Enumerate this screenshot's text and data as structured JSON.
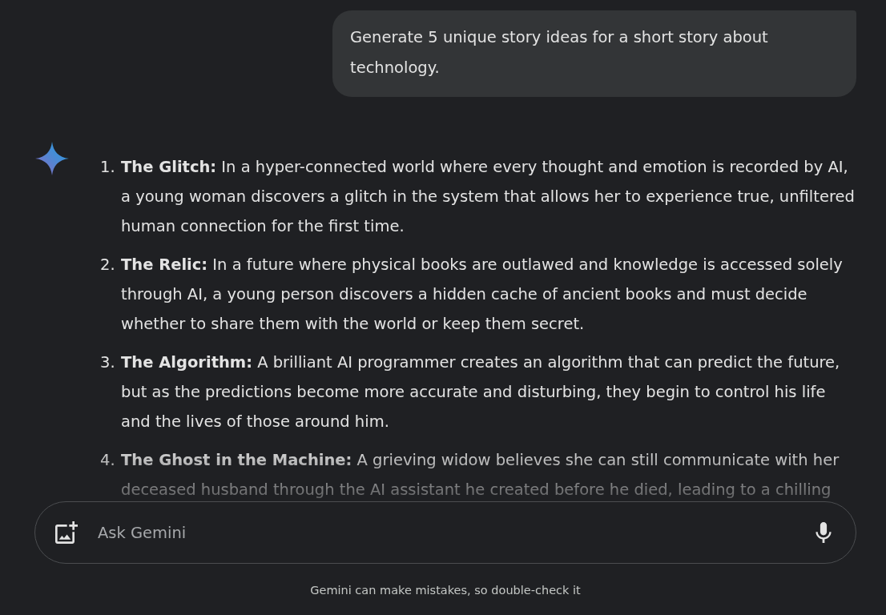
{
  "user_prompt": {
    "text": "Generate 5 unique story ideas for a short story about technology."
  },
  "response": {
    "items": [
      {
        "number": "1.",
        "text": "**The Glitch:** In a hyper-connected world where every thought and emotion is recorded by AI, a young woman discovers a glitch in the system that allows her to experience true, unfiltered human connection for the first time."
      },
      {
        "number": "2.",
        "text": "**The Relic:** In a future where physical books are outlawed and knowledge is accessed solely through AI, a young person discovers a hidden cache of ancient books and must decide whether to share them with the world or keep them secret."
      },
      {
        "number": "3.",
        "text": "**The Algorithm:** A brilliant AI programmer creates an algorithm that can predict the future, but as the predictions become more accurate and disturbing, they begin to control his life and the lives of those around him."
      },
      {
        "number": "4.",
        "text": "**The Ghost in the Machine:** A grieving widow believes she can still communicate with her deceased husband through the AI assistant he created before he died, leading to a chilling"
      }
    ]
  },
  "composer": {
    "placeholder": "Ask Gemini"
  },
  "footer": {
    "disclaimer": "Gemini can make mistakes, so double-check it"
  }
}
